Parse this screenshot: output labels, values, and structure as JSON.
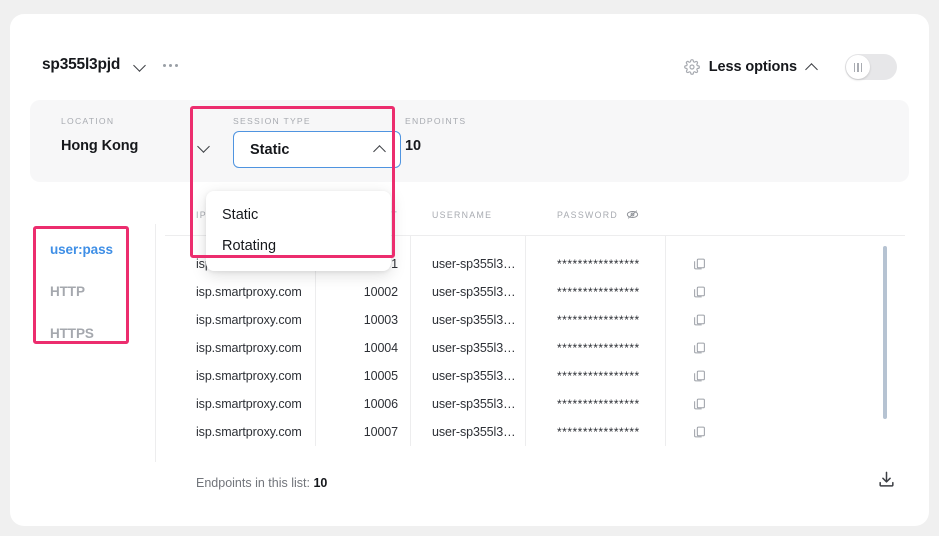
{
  "header": {
    "proxy_title": "sp355l3pjd",
    "title_chevron_icon": "chevron-down-icon",
    "more_menu_icon": "ellipsis-icon",
    "gear_icon": "gear-icon",
    "options_label": "Less options",
    "options_chevron_icon": "chevron-up-icon",
    "toggle_state": "off"
  },
  "filters": {
    "location": {
      "label": "LOCATION",
      "value": "Hong Kong",
      "chevron_icon": "chevron-down-icon"
    },
    "session_type": {
      "label": "SESSION TYPE",
      "value": "Static",
      "chevron_icon": "chevron-up-icon",
      "expanded": true,
      "options": [
        "Static",
        "Rotating"
      ]
    },
    "endpoints": {
      "label": "ENDPOINTS",
      "value": "10"
    }
  },
  "protocols": {
    "items": [
      {
        "label": "user:pass",
        "active": true
      },
      {
        "label": "HTTP",
        "active": false
      },
      {
        "label": "HTTPS",
        "active": false
      }
    ]
  },
  "table": {
    "columns": [
      "IP",
      "PORT",
      "USERNAME",
      "PASSWORD"
    ],
    "password_visibility_icon": "eye-off-icon",
    "copy_icon": "copy-icon",
    "rows": [
      {
        "ip": "isp.smartproxy.com",
        "port": "10001",
        "username": "user-sp355l3…",
        "password": "****************"
      },
      {
        "ip": "isp.smartproxy.com",
        "port": "10002",
        "username": "user-sp355l3…",
        "password": "****************"
      },
      {
        "ip": "isp.smartproxy.com",
        "port": "10003",
        "username": "user-sp355l3…",
        "password": "****************"
      },
      {
        "ip": "isp.smartproxy.com",
        "port": "10004",
        "username": "user-sp355l3…",
        "password": "****************"
      },
      {
        "ip": "isp.smartproxy.com",
        "port": "10005",
        "username": "user-sp355l3…",
        "password": "****************"
      },
      {
        "ip": "isp.smartproxy.com",
        "port": "10006",
        "username": "user-sp355l3…",
        "password": "****************"
      },
      {
        "ip": "isp.smartproxy.com",
        "port": "10007",
        "username": "user-sp355l3…",
        "password": "****************"
      }
    ]
  },
  "footer": {
    "count_label": "Endpoints in this list:",
    "count_value": "10",
    "download_icon": "download-icon"
  },
  "colors": {
    "accent_blue": "#3f8fe6",
    "focus_blue": "#4f94e0",
    "highlight_pink": "#ec2d6e",
    "page_bg": "#f0f0f0",
    "filter_bg": "#f7f7f8"
  }
}
